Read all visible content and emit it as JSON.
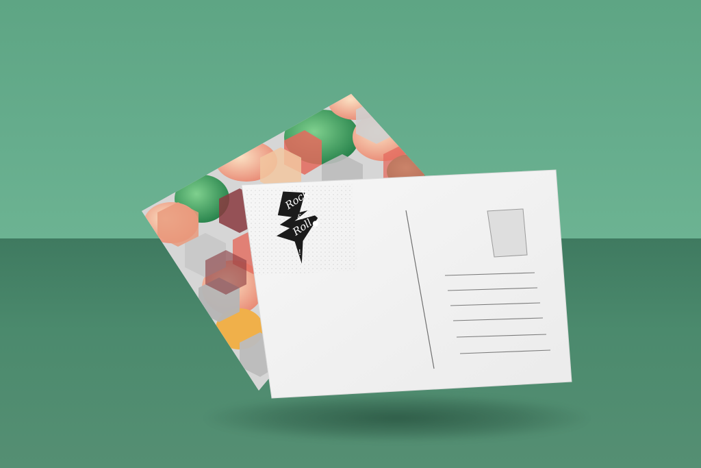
{
  "scene": {
    "wall_color": "#64ab8b",
    "floor_color": "#4a876b",
    "card_color": "#f2f2f2"
  },
  "postcard_front": {
    "logo_text": [
      "Rock",
      "&",
      "Roll",
      "!"
    ],
    "logo_color": "#1b1b1b",
    "address_lines": 6,
    "stamp_box_color": "#dedede"
  },
  "postcard_back": {
    "pattern": "hexagon-cubes-with-leaf-photos",
    "colors": [
      "#2f9a5a",
      "#e46a5d",
      "#f2c7a0",
      "#c8c8c8",
      "#8a3a40",
      "#f0b04a"
    ]
  }
}
